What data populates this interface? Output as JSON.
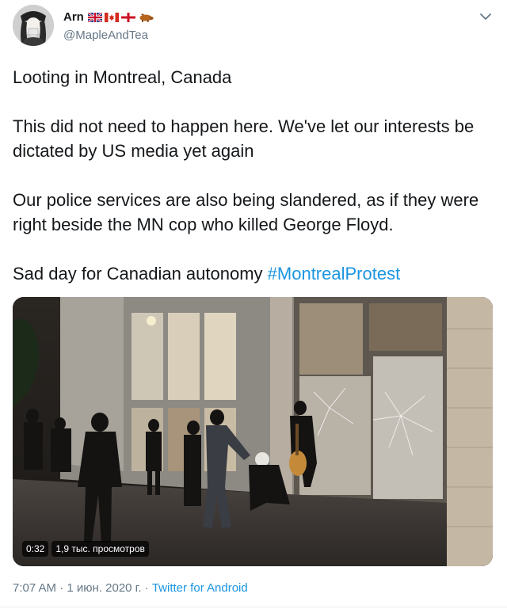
{
  "author": {
    "display_name": "Arn",
    "handle": "@MapleAndTea",
    "avatar_icon": "avatar-portrait-icon",
    "flags": [
      "uk-flag-icon",
      "canada-flag-icon",
      "england-flag-icon",
      "boar-emoji-icon"
    ]
  },
  "tweet": {
    "paragraphs": [
      "Looting in Montreal, Canada",
      "This did not need to happen here. We've let our interests be dictated by US media yet again",
      "Our police services are also being slandered, as if they were right beside the MN cop who killed George Floyd."
    ],
    "last_paragraph_text": "Sad day for Canadian autonomy ",
    "hashtag": "#MontrealProtest"
  },
  "media": {
    "duration": "0:32",
    "views": "1,9 тыс. просмотров"
  },
  "meta": {
    "time": "7:07 AM",
    "separator": " · ",
    "date": "1 июн. 2020 г.",
    "source": "Twitter for Android"
  },
  "colors": {
    "link": "#1b95e0",
    "secondary_text": "#657786",
    "primary_text": "#14171a"
  }
}
